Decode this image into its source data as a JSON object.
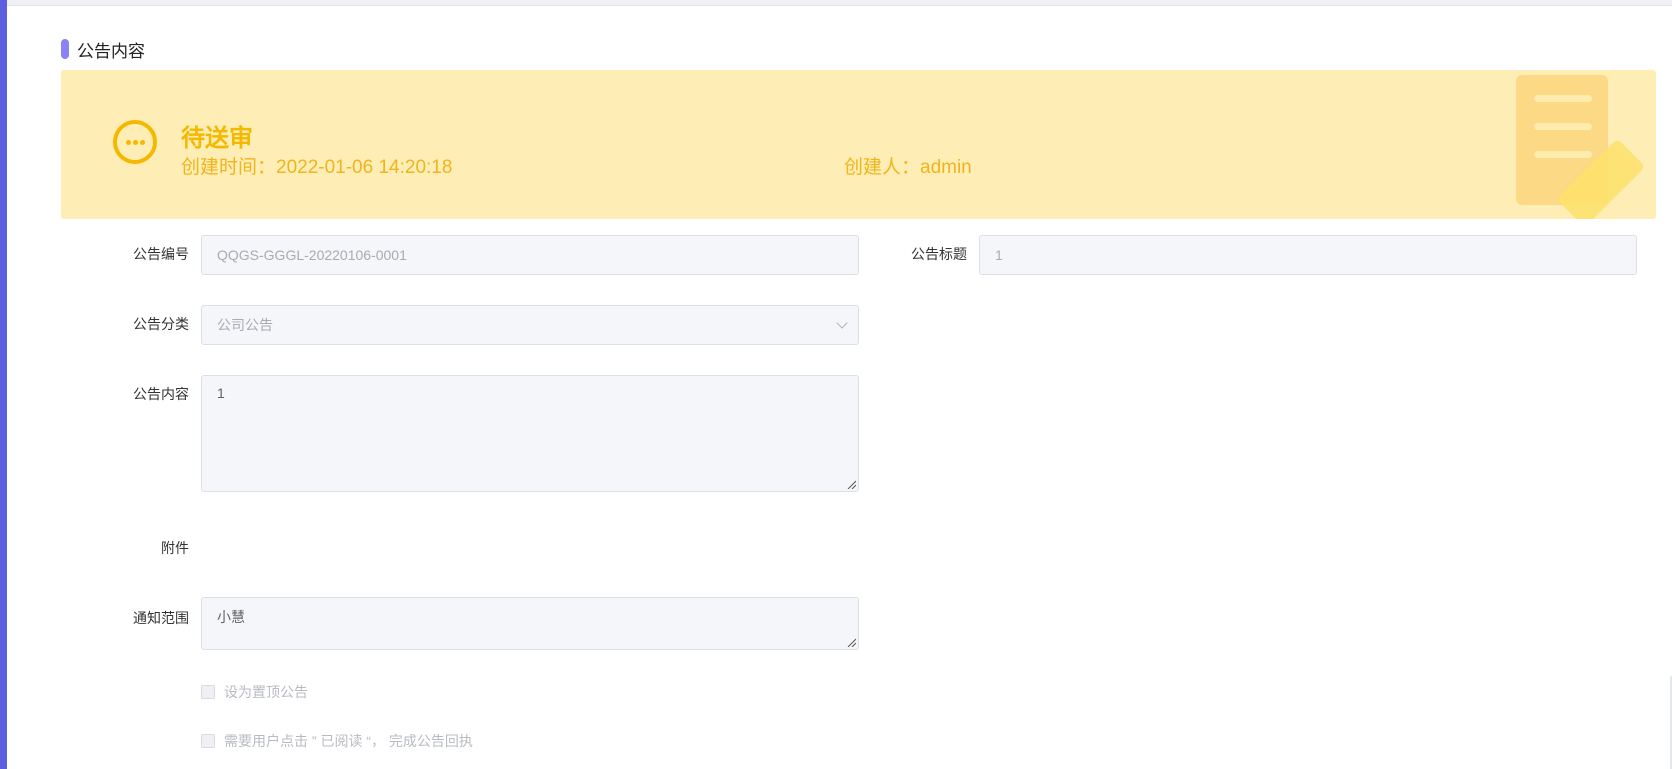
{
  "section": {
    "title": "公告内容"
  },
  "status": {
    "label": "待送审",
    "created_time": "创建时间：2022-01-06 14:20:18",
    "creator": "创建人：admin",
    "icon": "more-dots-circle-icon",
    "accent": "#f5b800",
    "banner_bg": "#feeeb5"
  },
  "form": {
    "notice_no": {
      "label": "公告编号",
      "value": "QQGS-GGGL-20220106-0001"
    },
    "notice_title": {
      "label": "公告标题",
      "value": "1"
    },
    "notice_category": {
      "label": "公告分类",
      "value": "公司公告"
    },
    "notice_content": {
      "label": "公告内容",
      "value": "1"
    },
    "attachment": {
      "label": "附件"
    },
    "notify_scope": {
      "label": "通知范围",
      "value": "小慧"
    }
  },
  "options": {
    "pin_top": {
      "label": "设为置顶公告",
      "checked": false
    },
    "read_receipt": {
      "label": "需要用户点击 ” 已阅读 “， 完成公告回执",
      "checked": false
    }
  }
}
